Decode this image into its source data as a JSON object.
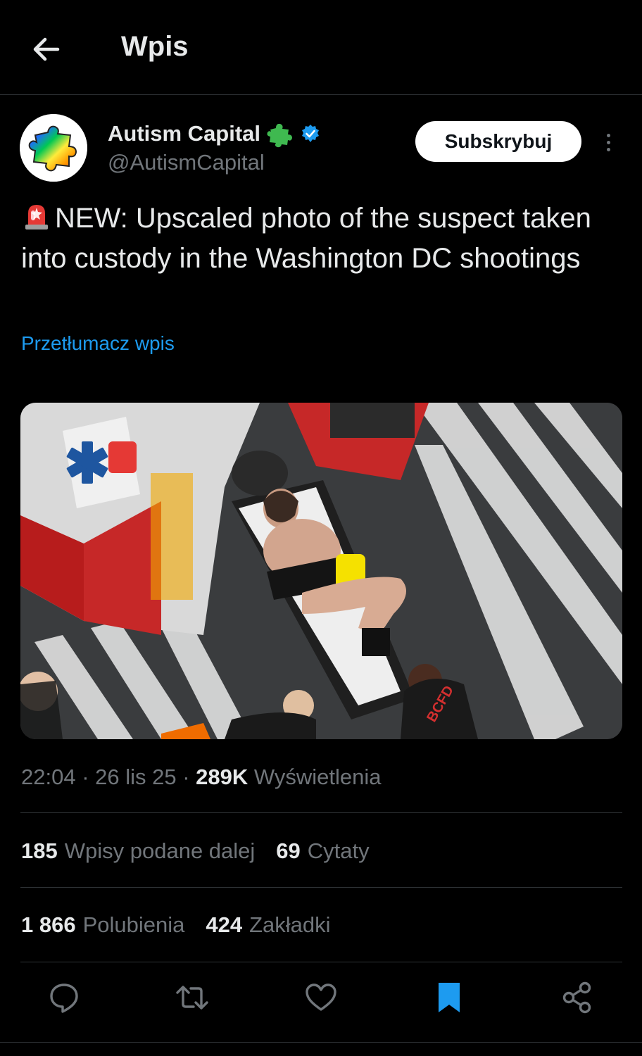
{
  "header": {
    "title": "Wpis",
    "back_icon": "arrow-left-icon"
  },
  "author": {
    "name": "Autism Capital",
    "handle": "@AutismCapital",
    "badge_icon": "puzzle-piece-icon",
    "verified_icon": "verified-badge-icon"
  },
  "subscribe_label": "Subskrybuj",
  "tweet": {
    "emoji_icon": "police-light-icon",
    "text": "NEW: Upscaled photo of the suspect taken into custody in the Washington DC shootings",
    "translate_label": "Przetłumacz wpis"
  },
  "photo": {
    "label": "BCFD"
  },
  "meta": {
    "time": "22:04",
    "sep1": " · ",
    "date": "26 lis 25",
    "sep2": " · ",
    "views_count": "289K",
    "views_label": "Wyświetlenia"
  },
  "stats": {
    "reposts_count": "185",
    "reposts_label": "Wpisy podane dalej",
    "quotes_count": "69",
    "quotes_label": "Cytaty",
    "likes_count": "1 866",
    "likes_label": "Polubienia",
    "bookmarks_count": "424",
    "bookmarks_label": "Zakładki"
  },
  "actions": [
    "reply-icon",
    "repost-icon",
    "like-icon",
    "bookmark-icon",
    "share-icon"
  ],
  "colors": {
    "accent": "#1d9bf0",
    "background": "#000000",
    "muted": "#71767b",
    "text": "#e7e9ea",
    "badge_green": "#3fb950"
  }
}
